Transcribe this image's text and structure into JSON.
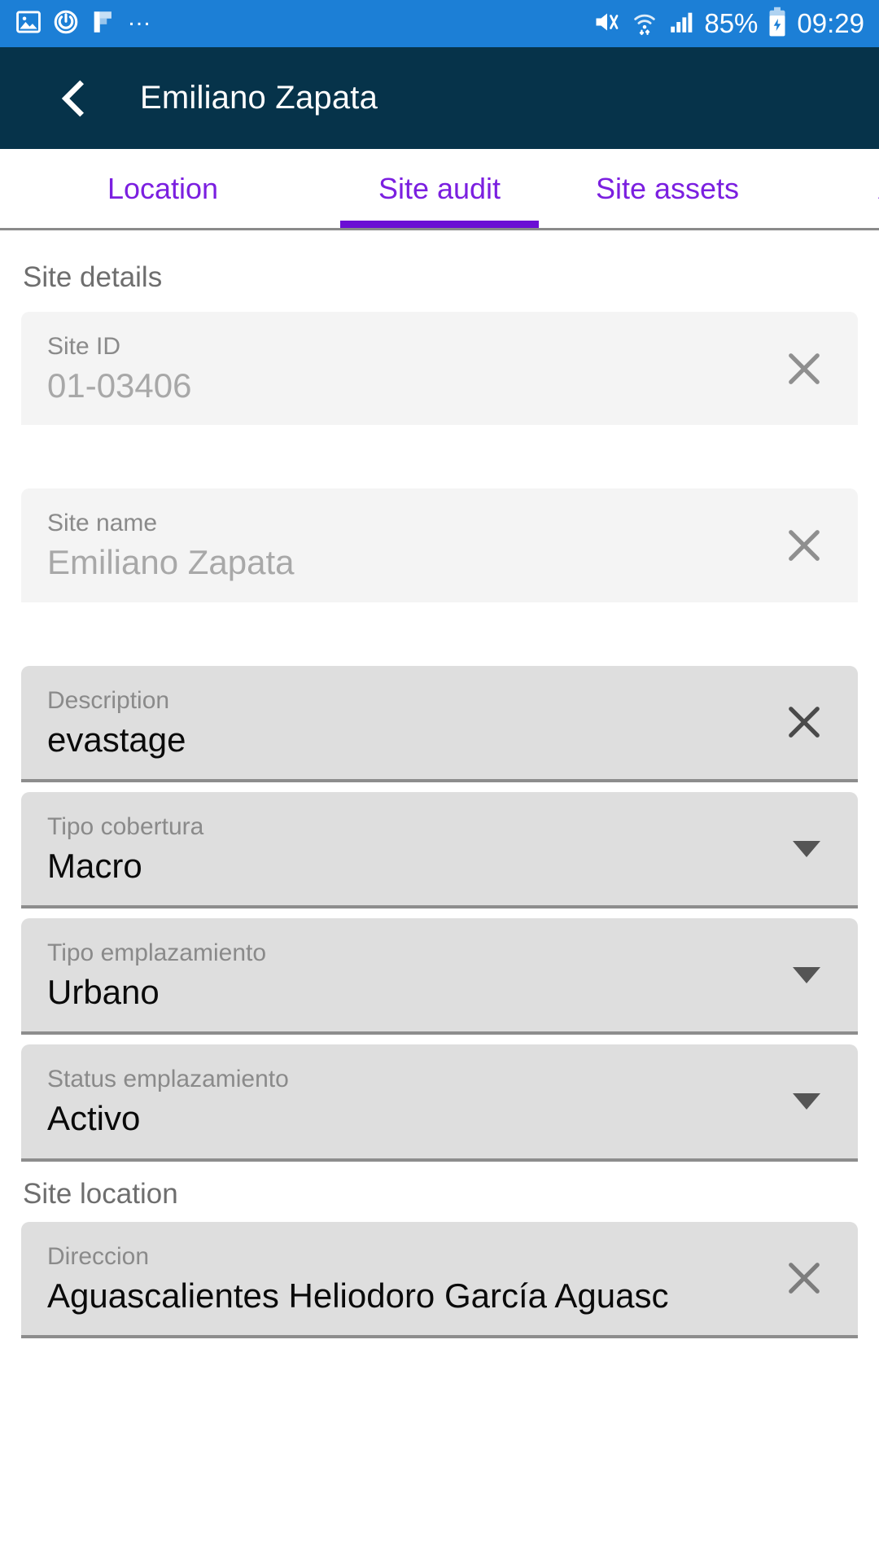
{
  "status_bar": {
    "left_icons": [
      "image-icon",
      "power-circle-icon",
      "flag-icon"
    ],
    "overflow": "…",
    "right_icons": [
      "mute-vibrate-icon",
      "wifi-icon",
      "signal-bars-icon",
      "battery-charging-icon"
    ],
    "battery_percent": "85%",
    "time": "09:29",
    "background_color": "#1c7fd6"
  },
  "app_bar": {
    "back_label": "back",
    "title": "Emiliano Zapata",
    "background_color": "#06334a"
  },
  "tabs": {
    "accent_color": "#6a0fd4",
    "items": [
      {
        "label": "Location",
        "active": false
      },
      {
        "label": "Site audit",
        "active": true
      },
      {
        "label": "Site assets",
        "active": false
      },
      {
        "label": "Ac",
        "active": false
      }
    ]
  },
  "sections": [
    {
      "title": "Site details",
      "fields": [
        {
          "label": "Site ID",
          "value": "01-03406",
          "style": "light",
          "control": "clear"
        },
        {
          "label": "Site name",
          "value": "Emiliano Zapata",
          "style": "light",
          "control": "clear"
        },
        {
          "label": "Description",
          "value": "evastage",
          "style": "dark",
          "control": "clear"
        },
        {
          "label": "Tipo cobertura",
          "value": "Macro",
          "style": "dark",
          "control": "dropdown"
        },
        {
          "label": "Tipo emplazamiento",
          "value": "Urbano",
          "style": "dark",
          "control": "dropdown"
        },
        {
          "label": "Status emplazamiento",
          "value": "Activo",
          "style": "dark",
          "control": "dropdown"
        }
      ]
    },
    {
      "title": "Site location",
      "fields": [
        {
          "label": "Direccion",
          "value": "Aguascalientes Heliodoro García Aguasc",
          "style": "dark",
          "control": "clear"
        }
      ]
    }
  ]
}
